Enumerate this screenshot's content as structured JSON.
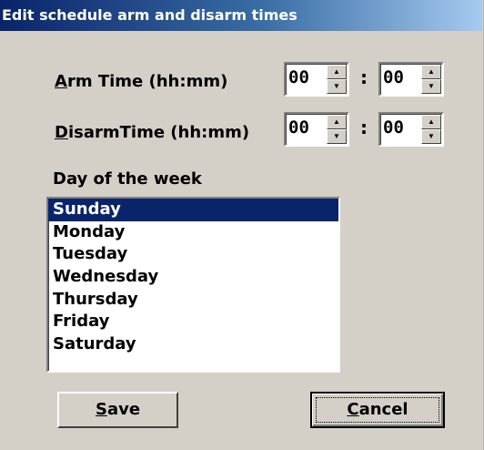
{
  "window": {
    "title": "Edit schedule arm and disarm times"
  },
  "arm": {
    "label_mnemonic": "A",
    "label_rest": "rm Time (hh:mm)",
    "hours": "00",
    "minutes": "00"
  },
  "disarm": {
    "label_mnemonic": "D",
    "label_rest": "isarmTime (hh:mm)",
    "hours": "00",
    "minutes": "00"
  },
  "separator": ":",
  "days": {
    "label": "Day of the week",
    "items": [
      "Sunday",
      "Monday",
      "Tuesday",
      "Wednesday",
      "Thursday",
      "Friday",
      "Saturday"
    ],
    "selected": "Sunday"
  },
  "buttons": {
    "save_mnemonic": "S",
    "save_rest": "ave",
    "cancel_mnemonic": "C",
    "cancel_rest": "ancel"
  },
  "icons": {
    "spin_up": "spin-up-arrow-icon",
    "spin_down": "spin-down-arrow-icon"
  },
  "colors": {
    "dialog_bg": "#d4d0c8",
    "selection": "#0a246a",
    "title_start": "#0a246a",
    "title_end": "#a6caf0"
  }
}
